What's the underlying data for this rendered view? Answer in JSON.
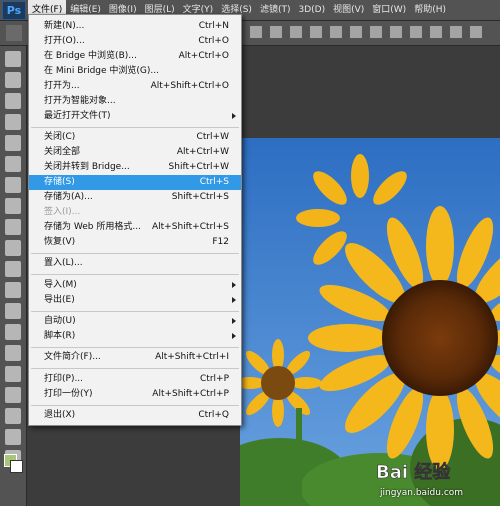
{
  "app": {
    "logo_text": "Ps"
  },
  "menubar": {
    "items": [
      {
        "label": "文件(F)",
        "active": true
      },
      {
        "label": "编辑(E)"
      },
      {
        "label": "图像(I)"
      },
      {
        "label": "图层(L)"
      },
      {
        "label": "文字(Y)"
      },
      {
        "label": "选择(S)"
      },
      {
        "label": "滤镜(T)"
      },
      {
        "label": "3D(D)"
      },
      {
        "label": "视图(V)"
      },
      {
        "label": "窗口(W)"
      },
      {
        "label": "帮助(H)"
      }
    ]
  },
  "file_menu": {
    "items": [
      {
        "label": "新建(N)...",
        "shortcut": "Ctrl+N"
      },
      {
        "label": "打开(O)...",
        "shortcut": "Ctrl+O"
      },
      {
        "label": "在 Bridge 中浏览(B)...",
        "shortcut": "Alt+Ctrl+O"
      },
      {
        "label": "在 Mini Bridge 中浏览(G)...",
        "shortcut": ""
      },
      {
        "label": "打开为...",
        "shortcut": "Alt+Shift+Ctrl+O"
      },
      {
        "label": "打开为智能对象...",
        "shortcut": ""
      },
      {
        "label": "最近打开文件(T)",
        "shortcut": "",
        "submenu": true
      },
      {
        "label": "关闭(C)",
        "shortcut": "Ctrl+W"
      },
      {
        "label": "关闭全部",
        "shortcut": "Alt+Ctrl+W"
      },
      {
        "label": "关闭并转到 Bridge...",
        "shortcut": "Shift+Ctrl+W"
      },
      {
        "label": "存储(S)",
        "shortcut": "Ctrl+S",
        "highlighted": true
      },
      {
        "label": "存储为(A)...",
        "shortcut": "Shift+Ctrl+S"
      },
      {
        "label": "签入(I)...",
        "shortcut": "",
        "disabled": true
      },
      {
        "label": "存储为 Web 所用格式...",
        "shortcut": "Alt+Shift+Ctrl+S"
      },
      {
        "label": "恢复(V)",
        "shortcut": "F12"
      },
      {
        "label": "置入(L)...",
        "shortcut": ""
      },
      {
        "label": "导入(M)",
        "shortcut": "",
        "submenu": true
      },
      {
        "label": "导出(E)",
        "shortcut": "",
        "submenu": true
      },
      {
        "label": "自动(U)",
        "shortcut": "",
        "submenu": true
      },
      {
        "label": "脚本(R)",
        "shortcut": "",
        "submenu": true
      },
      {
        "label": "文件简介(F)...",
        "shortcut": "Alt+Shift+Ctrl+I"
      },
      {
        "label": "打印(P)...",
        "shortcut": "Ctrl+P"
      },
      {
        "label": "打印一份(Y)",
        "shortcut": "Alt+Shift+Ctrl+P"
      },
      {
        "label": "退出(X)",
        "shortcut": "Ctrl+Q"
      }
    ]
  },
  "watermark": {
    "logo": "Bai 经验",
    "url": "jingyan.baidu.com"
  },
  "colors": {
    "highlight": "#3299e6",
    "fg_swatch": "#a8c67a",
    "bg_swatch": "#ffffff"
  }
}
